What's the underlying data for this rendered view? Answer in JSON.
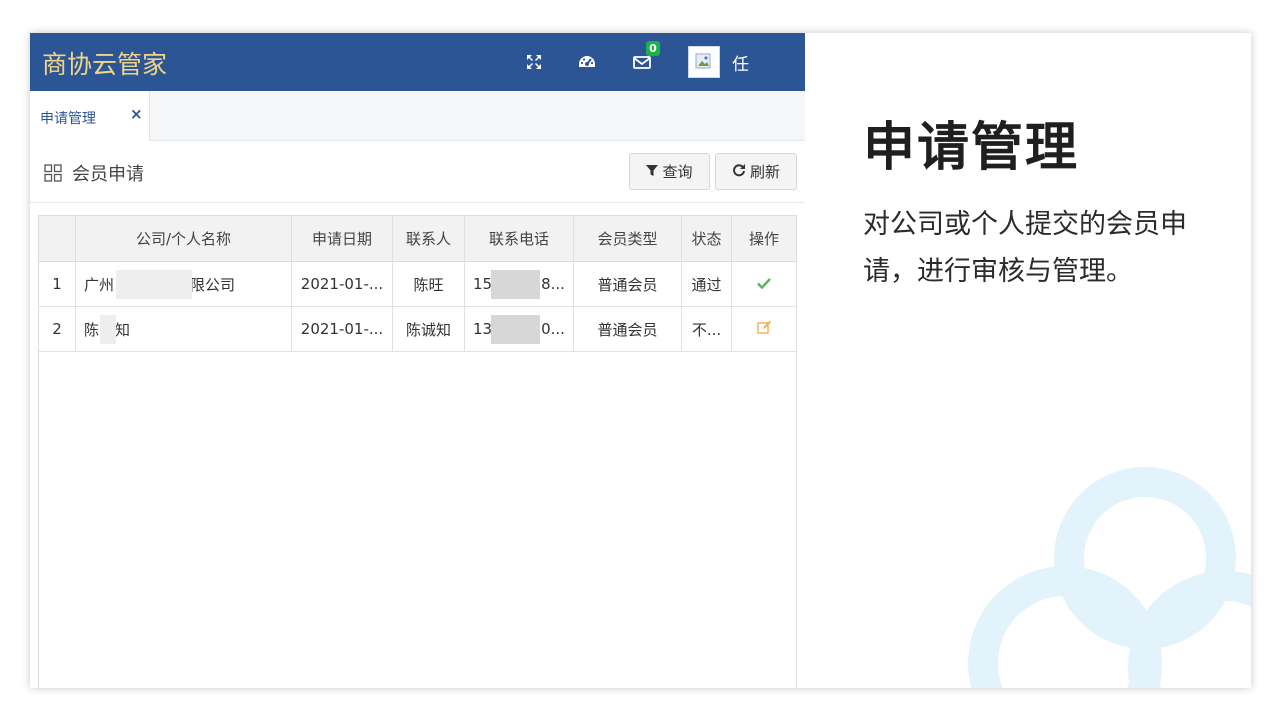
{
  "app": {
    "brand": "商协云管家",
    "mail_badge": "0",
    "user_name": "任"
  },
  "tabs": [
    {
      "label": "申请管理",
      "close": "×"
    }
  ],
  "panel": {
    "title": "会员申请",
    "query_label": "查询",
    "refresh_label": "刷新"
  },
  "table": {
    "columns": [
      "",
      "公司/个人名称",
      "申请日期",
      "联系人",
      "联系电话",
      "会员类型",
      "状态",
      "操作"
    ],
    "rows": [
      {
        "index": "1",
        "name_start": "广州",
        "name_end": "限公司",
        "date": "2021-01-...",
        "contact": "陈旺",
        "phone_start": "15",
        "phone_end": "8...",
        "type": "普通会员",
        "status": "通过",
        "action": "check-icon"
      },
      {
        "index": "2",
        "name_start": "陈",
        "name_end": "知",
        "date": "2021-01-...",
        "contact": "陈诚知",
        "phone_start": "13",
        "phone_end": "0...",
        "type": "普通会员",
        "status": "不...",
        "action": "edit-icon"
      }
    ]
  },
  "side": {
    "title": "申请管理",
    "description": "对公司或个人提交的会员申请，进行审核与管理。"
  },
  "colors": {
    "topbar": "#2c5596",
    "brand_text": "#f2d489",
    "badge": "#1ab34a",
    "check": "#5cb85c",
    "edit": "#f0ad4e",
    "cloud": "#e3f3fc"
  }
}
